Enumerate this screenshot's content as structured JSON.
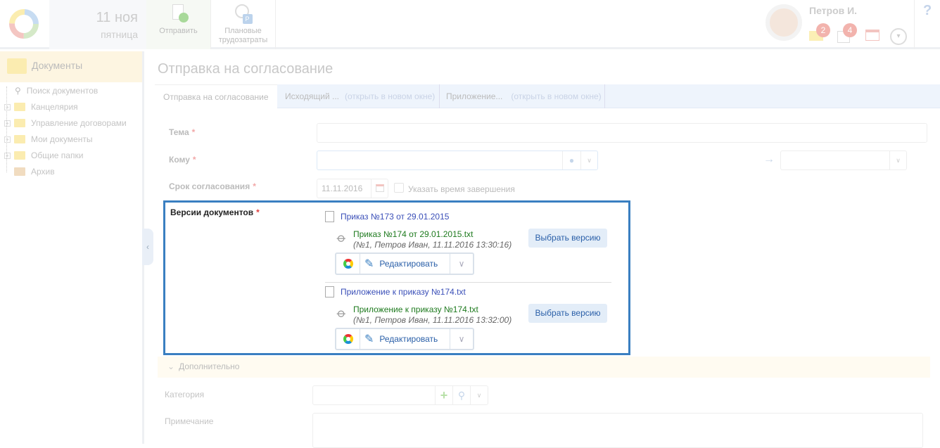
{
  "header": {
    "date": "11 ноя",
    "weekday": "пятница",
    "toolbar": [
      {
        "label": "Отправить"
      },
      {
        "label": "Плановые трудозатраты"
      }
    ],
    "user": "Петров И.",
    "mail_count": "2",
    "tasks_count": "4",
    "help": "?"
  },
  "sidebar": {
    "title": "Документы",
    "items": [
      "Поиск документов",
      "Канцелярия",
      "Управление договорами",
      "Мои документы",
      "Общие папки",
      "Архив"
    ]
  },
  "page": {
    "title": "Отправка на согласование",
    "tabs": [
      {
        "label": "Отправка на согласование"
      },
      {
        "label": "Исходящий ...",
        "open": "(открыть в новом окне)"
      },
      {
        "label": "Приложение...",
        "open": "(открыть в новом окне)"
      }
    ]
  },
  "form": {
    "subject_label": "Тема",
    "to_label": "Кому",
    "deadline_label": "Срок согласования",
    "deadline_value": "11.11.2016",
    "set_time_label": "Указать время завершения",
    "required": "*",
    "versions_label": "Версии документов",
    "documents": [
      {
        "title": "Приказ №173 от 29.01.2015",
        "file": "Приказ №174 от 29.01.2015.txt",
        "meta": "(№1, Петров Иван, 11.11.2016 13:30:16)",
        "select": "Выбрать версию",
        "edit": "Редактировать"
      },
      {
        "title": "Приложение к приказу №174.txt",
        "file": "Приложение к приказу №174.txt",
        "meta": "(№1, Петров Иван, 11.11.2016 13:32:00)",
        "select": "Выбрать версию",
        "edit": "Редактировать"
      }
    ],
    "additional_label": "Дополнительно",
    "category_label": "Категория",
    "note_label": "Примечание"
  }
}
